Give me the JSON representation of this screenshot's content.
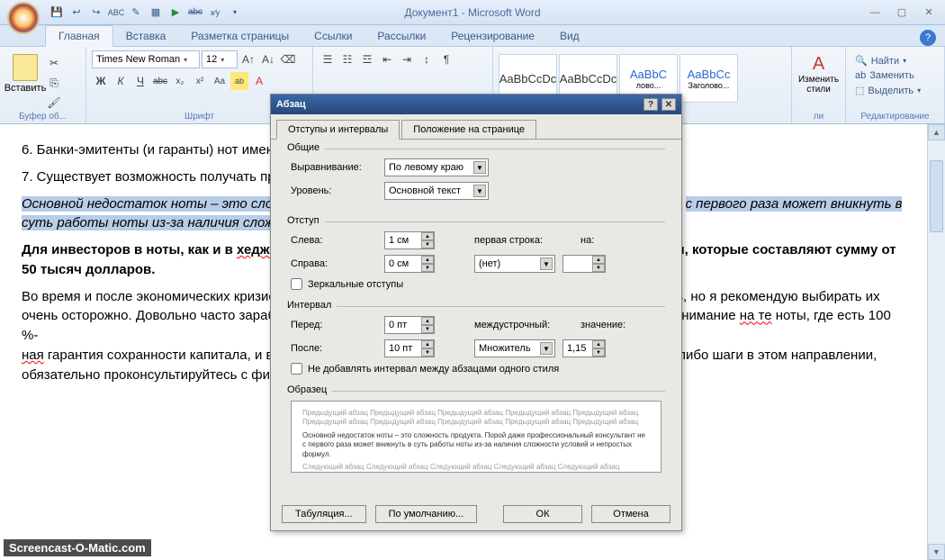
{
  "window": {
    "title": "Документ1 - Microsoft Word"
  },
  "qat": [
    "💾",
    "↩",
    "↪",
    "ABC",
    "✎",
    "📄",
    "▶",
    "abc",
    "x/y",
    "▾"
  ],
  "tabs": [
    "Главная",
    "Вставка",
    "Разметка страницы",
    "Ссылки",
    "Рассылки",
    "Рецензирование",
    "Вид"
  ],
  "ribbon": {
    "paste": "Вставить",
    "clipboard_group": "Буфер об...",
    "font_name": "Times New Roman",
    "font_size": "12",
    "font_group": "Шрифт",
    "styles": [
      {
        "preview": "AaBbCcDc",
        "name": "",
        "blue": false
      },
      {
        "preview": "AaBbCcDc",
        "name": "",
        "blue": false
      },
      {
        "preview": "AaBbC",
        "name": "лово...",
        "blue": true
      },
      {
        "preview": "AaBbCc",
        "name": "Заголово...",
        "blue": true
      }
    ],
    "change_styles": "Изменить стили",
    "styles_group": "ли",
    "find": "Найти",
    "replace": "Заменить",
    "select": "Выделить",
    "editing_group": "Редактирование"
  },
  "doc": {
    "p6": "6. Банки-эмитенты (и гаранты) нот имею",
    "p7": "7. Существует возможность получать при",
    "sel1": "Основной недостаток ноты – это слож",
    "sel2": "с первого раза может вникнуть в",
    "sel3": "суть работы ноты из-за наличия сложно",
    "bold1": "Для инвесторов в ноты, как и в ",
    "bold1b": "хеджев",
    "bold2": "ги, которые составляют сумму от 50 тысяч долларов.",
    "p8a": "Во время и после экономических кризисо",
    "p8b": "ов, но я рекомендую выбирать их очень осторожно. Довольно часто заработ",
    "p8c": "внимание ",
    "p8d": "на те",
    "p8e": " ноты, где есть 100 %-",
    "p8f": "ная",
    "p8g": " гарантия сохранности капитала, и вп",
    "p8h": "е-либо шаги в этом направлении, обязательно проконсультируйтесь с фина"
  },
  "dialog": {
    "title": "Абзац",
    "tab1": "Отступы и интервалы",
    "tab2": "Положение на странице",
    "general": "Общие",
    "alignment_lbl": "Выравнивание:",
    "alignment_val": "По левому краю",
    "level_lbl": "Уровень:",
    "level_val": "Основной текст",
    "indent": "Отступ",
    "left_lbl": "Слева:",
    "left_val": "1 см",
    "right_lbl": "Справа:",
    "right_val": "0 см",
    "firstline_lbl": "первая строка:",
    "firstline_val": "(нет)",
    "by_lbl": "на:",
    "by_val": "",
    "mirror": "Зеркальные отступы",
    "spacing": "Интервал",
    "before_lbl": "Перед:",
    "before_val": "0 пт",
    "after_lbl": "После:",
    "after_val": "10 пт",
    "linespace_lbl": "междустрочный:",
    "linespace_val": "Множитель",
    "at_lbl": "значение:",
    "at_val": "1,15",
    "noadd": "Не добавлять интервал между абзацами одного стиля",
    "sample": "Образец",
    "sample_grey": "Предыдущий абзац Предыдущий абзац Предыдущий абзац Предыдущий абзац Предыдущий абзац Предыдущий абзац Предыдущий абзац Предыдущий абзац Предыдущий абзац Предыдущий абзац",
    "sample_dark": "Основной недостаток ноты – это сложность продукта. Порой даже профессиональный консультант не с первого раза может вникнуть в суть работы ноты из-за наличия сложности условий и непростых формул.",
    "sample_grey2": "Следующий абзац Следующий абзац Следующий абзац Следующий абзац Следующий абзац Следующий абзац",
    "tabs_btn": "Табуляция...",
    "default_btn": "По умолчанию...",
    "ok": "ОК",
    "cancel": "Отмена"
  },
  "watermark": "Screencast-O-Matic.com"
}
